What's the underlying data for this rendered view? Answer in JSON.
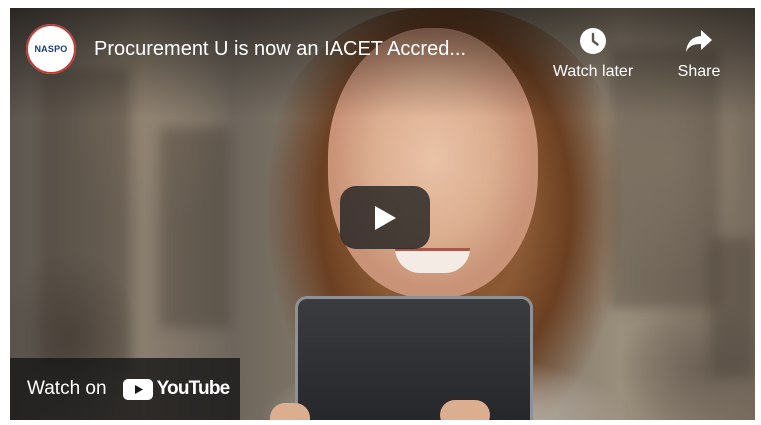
{
  "player": {
    "title": "Procurement U is now an IACET Accred...",
    "channel_logo_text": "NASPO",
    "actions": {
      "watch_later_label": "Watch later",
      "share_label": "Share"
    },
    "play_icon": "play-icon",
    "watch_on_label": "Watch on",
    "youtube_wordmark": "YouTube"
  },
  "colors": {
    "overlay": "#171717",
    "youtube_red": "#ff0000",
    "logo_ring": "#c23b36",
    "logo_text": "#1b3d80"
  }
}
